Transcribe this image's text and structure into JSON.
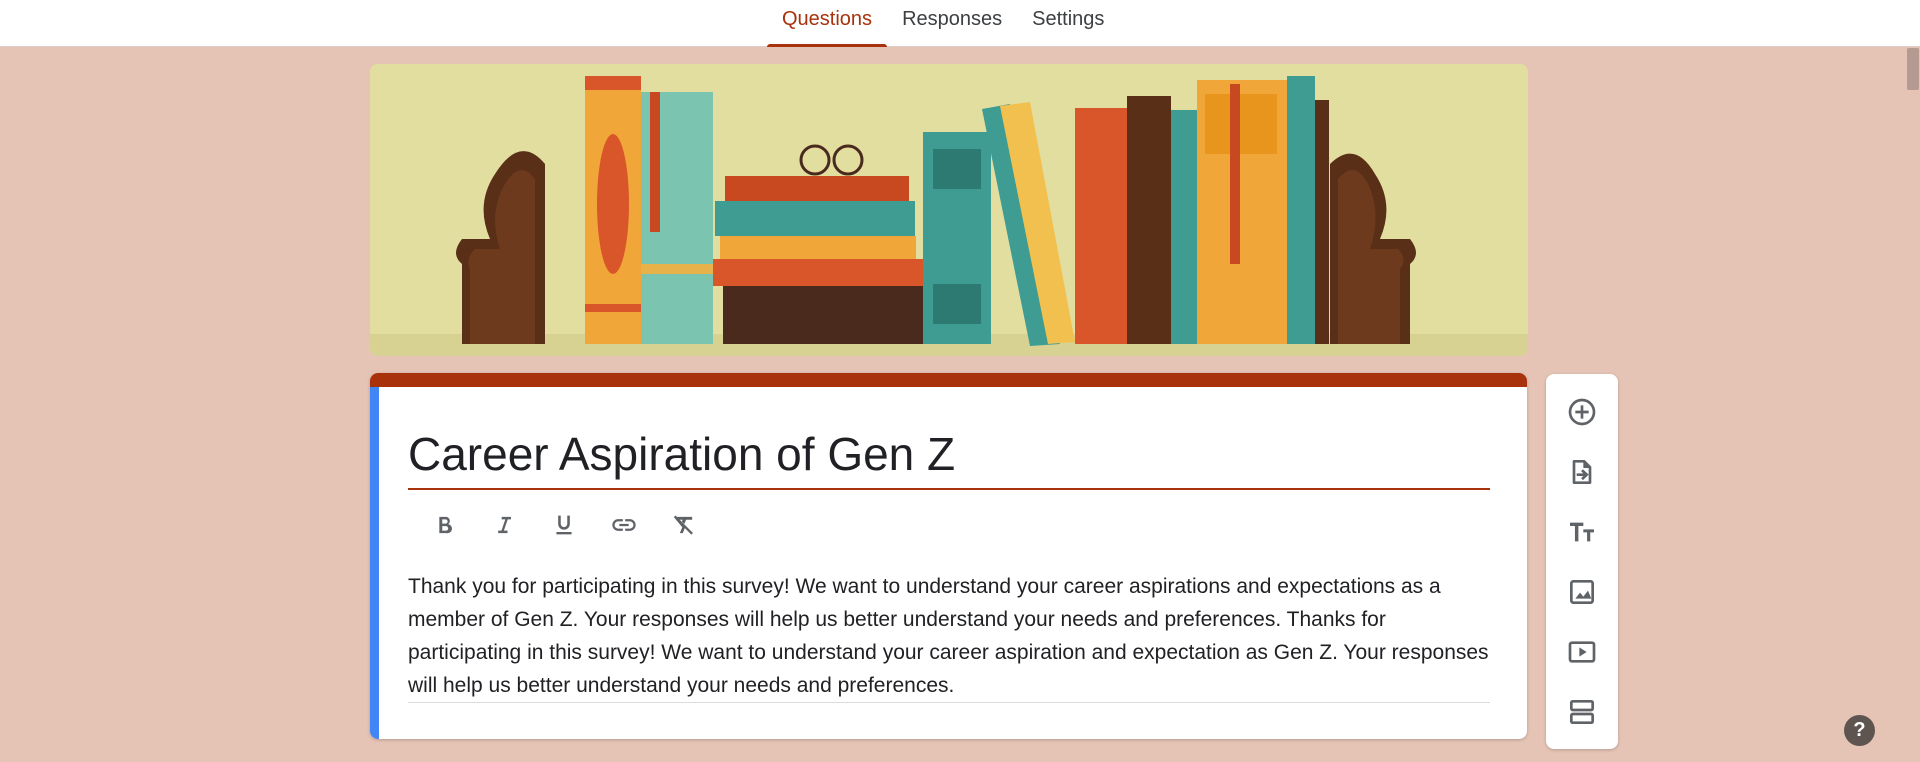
{
  "tabs": [
    {
      "label": "Questions"
    },
    {
      "label": "Responses"
    },
    {
      "label": "Settings"
    }
  ],
  "form": {
    "title": "Career Aspiration of Gen Z",
    "description": "Thank you for participating in this survey! We want to understand your career aspirations and expectations as a member of Gen Z. Your responses will help us better understand your needs and preferences. Thanks for participating in this survey! We want to understand your career aspiration and expectation as Gen Z. Your responses will help us better understand your needs and preferences."
  },
  "format_toolbar": [
    "bold-icon",
    "italic-icon",
    "underline-icon",
    "link-icon",
    "clear-formatting-icon"
  ],
  "side_toolbar": [
    "add-question-icon",
    "import-questions-icon",
    "add-title-icon",
    "add-image-icon",
    "add-video-icon",
    "add-section-icon"
  ],
  "help": {
    "label": "?"
  },
  "colors": {
    "theme": "#a8320c",
    "background": "#e5c3b5",
    "accent_left": "#4285f4"
  }
}
